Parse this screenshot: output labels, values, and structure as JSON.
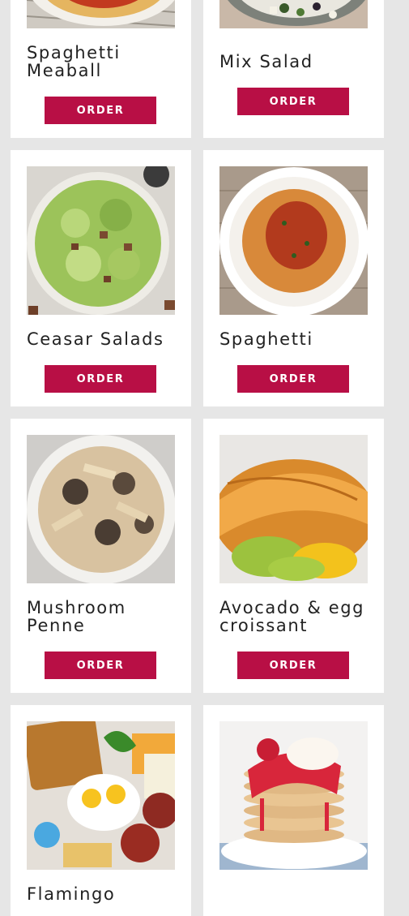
{
  "menu": {
    "items": [
      {
        "name": "Spaghetti Meaball",
        "button": "ORDER"
      },
      {
        "name": "Mix Salad",
        "button": "ORDER"
      },
      {
        "name": "Ceasar Salads",
        "button": "ORDER"
      },
      {
        "name": "Spaghetti",
        "button": "ORDER"
      },
      {
        "name": "Mushroom Penne",
        "button": "ORDER"
      },
      {
        "name": "Avocado & egg croissant",
        "button": "ORDER"
      },
      {
        "name": "Flamingo",
        "button": ""
      },
      {
        "name": "",
        "button": ""
      }
    ]
  },
  "colors": {
    "accent": "#b80f45",
    "background": "#e6e6e6",
    "card": "#ffffff"
  }
}
